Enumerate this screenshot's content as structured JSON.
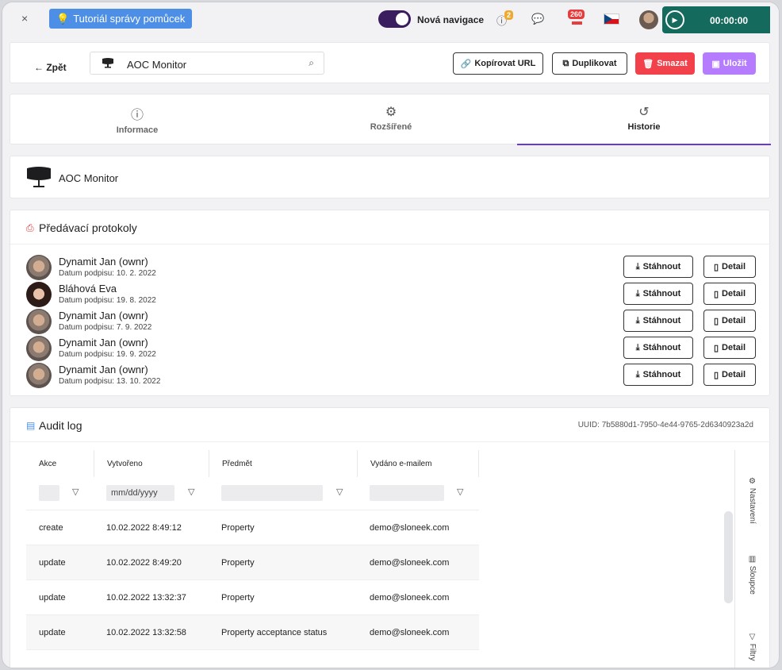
{
  "topbar": {
    "close": "×",
    "tutorial": "Tutoriál správy pomůcek",
    "nav_toggle_label": "Nová navigace",
    "alerts_badge": "2",
    "messages_badge": "260",
    "timer": "00:00:00"
  },
  "header": {
    "back": "Zpět",
    "search_value": "AOC Monitor",
    "copy_url": "Kopírovat URL",
    "duplicate": "Duplikovat",
    "delete": "Smazat",
    "save": "Uložit"
  },
  "tabs": [
    {
      "label": "Informace",
      "icon": "info-icon"
    },
    {
      "label": "Rozšířené",
      "icon": "gear-icon"
    },
    {
      "label": "Historie",
      "icon": "history-icon"
    }
  ],
  "item": {
    "name": "AOC Monitor"
  },
  "protocols": {
    "title": "Předávací protokoly",
    "download_label": "Stáhnout",
    "detail_label": "Detail",
    "rows": [
      {
        "name": "Dynamit Jan (ownr)",
        "date": "Datum podpisu: 10. 2. 2022"
      },
      {
        "name": "Bláhová Eva",
        "date": "Datum podpisu: 19. 8. 2022"
      },
      {
        "name": "Dynamit Jan (ownr)",
        "date": "Datum podpisu: 7. 9. 2022"
      },
      {
        "name": "Dynamit Jan (ownr)",
        "date": "Datum podpisu: 19. 9. 2022"
      },
      {
        "name": "Dynamit Jan (ownr)",
        "date": "Datum podpisu: 13. 10. 2022"
      }
    ]
  },
  "audit": {
    "title": "Audit log",
    "uuid": "UUID: 7b5880d1-7950-4e44-9765-2d6340923a2d",
    "columns": [
      "Akce",
      "Vytvořeno",
      "Předmět",
      "Vydáno e-mailem"
    ],
    "date_placeholder": "mm/dd/yyyy",
    "rows": [
      [
        "create",
        "10.02.2022 8:49:12",
        "Property",
        "demo@sloneek.com"
      ],
      [
        "update",
        "10.02.2022 8:49:20",
        "Property",
        "demo@sloneek.com"
      ],
      [
        "update",
        "10.02.2022 13:32:37",
        "Property",
        "demo@sloneek.com"
      ],
      [
        "update",
        "10.02.2022 13:32:58",
        "Property acceptance status",
        "demo@sloneek.com"
      ]
    ],
    "side": [
      "Nastavení",
      "Sloupce",
      "Filtry"
    ]
  }
}
